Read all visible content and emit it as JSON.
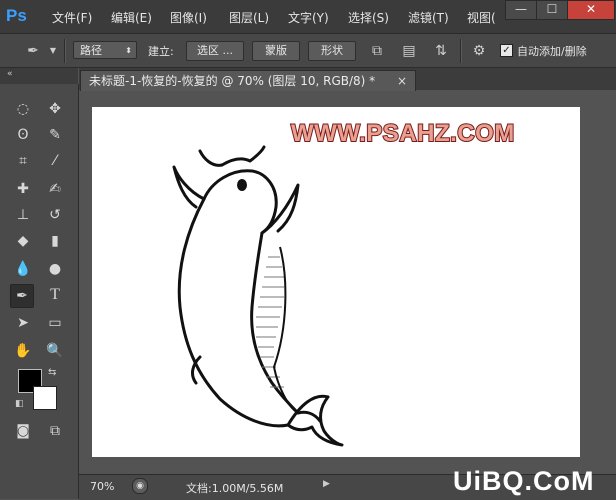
{
  "app": {
    "logo": "Ps"
  },
  "menu": [
    "文件(F)",
    "编辑(E)",
    "图像(I)",
    "图层(L)",
    "文字(Y)",
    "选择(S)",
    "滤镜(T)",
    "视图("
  ],
  "window_controls": {
    "minimize": "—",
    "maximize": "☐",
    "close": "✕"
  },
  "options_bar": {
    "mode_select": "路径",
    "make_label": "建立:",
    "selection_button": "选区 ...",
    "mask_button": "蒙版",
    "shape_button": "形状",
    "auto_add_delete_label": "自动添加/删除",
    "auto_add_delete_checked": true
  },
  "document": {
    "tab_title": "未标题-1-恢复的-恢复的 @ 70% (图层 10, RGB/8) *",
    "close": "×"
  },
  "canvas": {
    "watermark": "WWW.PSAHZ.COM"
  },
  "status": {
    "zoom": "70%",
    "doc_info": "文档:1.00M/5.56M"
  },
  "site_logo": {
    "text": "UiBQ.CoM"
  },
  "colors": {
    "foreground": "#000000",
    "background": "#ffffff",
    "accent": "#2ea3ff"
  }
}
